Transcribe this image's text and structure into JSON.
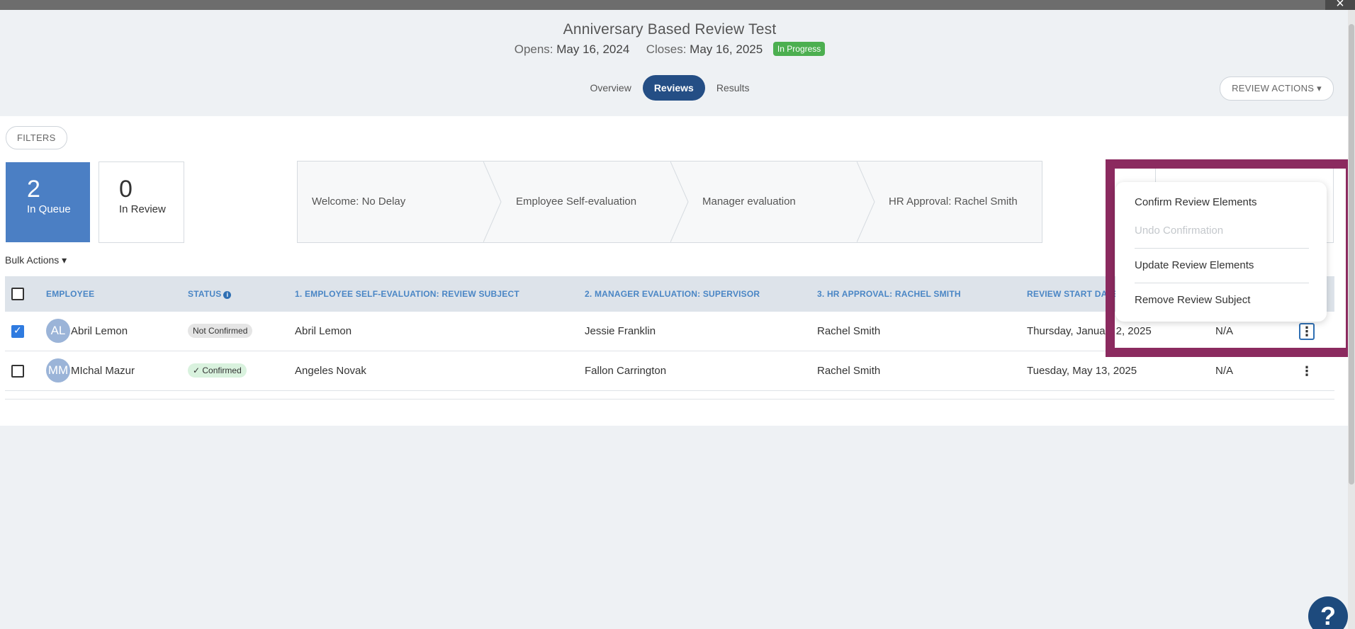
{
  "window": {
    "close_icon": "×"
  },
  "header": {
    "title": "Anniversary Based Review Test",
    "opens_label": "Opens:",
    "opens_value": "May 16, 2024",
    "closes_label": "Closes:",
    "closes_value": "May 16, 2025",
    "status": "In Progress",
    "status_color": "#4caf50"
  },
  "tabs": [
    {
      "label": "Overview",
      "active": false
    },
    {
      "label": "Reviews",
      "active": true
    },
    {
      "label": "Results",
      "active": false
    }
  ],
  "review_actions_label": "REVIEW ACTIONS",
  "filters_label": "FILTERS",
  "cards": {
    "queue": {
      "count": "2",
      "label": "In Queue"
    },
    "review": {
      "count": "0",
      "label": "In Review"
    }
  },
  "steps": [
    "Welcome: No Delay",
    "Employee Self-evaluation",
    "Manager evaluation",
    "HR Approval: Rachel Smith"
  ],
  "bulk_actions_label": "Bulk Actions",
  "table": {
    "columns": [
      "EMPLOYEE",
      "STATUS",
      "1. EMPLOYEE SELF-EVALUATION: REVIEW SUBJECT",
      "2. MANAGER EVALUATION: SUPERVISOR",
      "3. HR APPROVAL: RACHEL SMITH",
      "REVIEW START DATE"
    ],
    "rows": [
      {
        "checked": true,
        "initials": "AL",
        "name": "Abril Lemon",
        "status": "Not Confirmed",
        "self_eval": "Abril Lemon",
        "manager": "Jessie Franklin",
        "hr": "Rachel Smith",
        "start_date": "Thursday, Januar",
        "start_date_tail": "2, 2025",
        "extra": "N/A"
      },
      {
        "checked": false,
        "initials": "MM",
        "name": "MIchal Mazur",
        "status": "Confirmed",
        "self_eval": "Angeles Novak",
        "manager": "Fallon Carrington",
        "hr": "Rachel Smith",
        "start_date": "Tuesday, May 13, 2025",
        "extra": "N/A"
      }
    ]
  },
  "menu": {
    "items": [
      {
        "label": "Confirm Review Elements",
        "disabled": false
      },
      {
        "label": "Undo Confirmation",
        "disabled": true
      },
      {
        "label": "Update Review Elements",
        "disabled": false
      },
      {
        "label": "Remove Review Subject",
        "disabled": false
      }
    ]
  },
  "help_label": "?",
  "colors": {
    "accent": "#244e85",
    "queue_card": "#4b7fc4",
    "header_text": "#4a86c5",
    "highlight_border": "#8b2a5f"
  }
}
